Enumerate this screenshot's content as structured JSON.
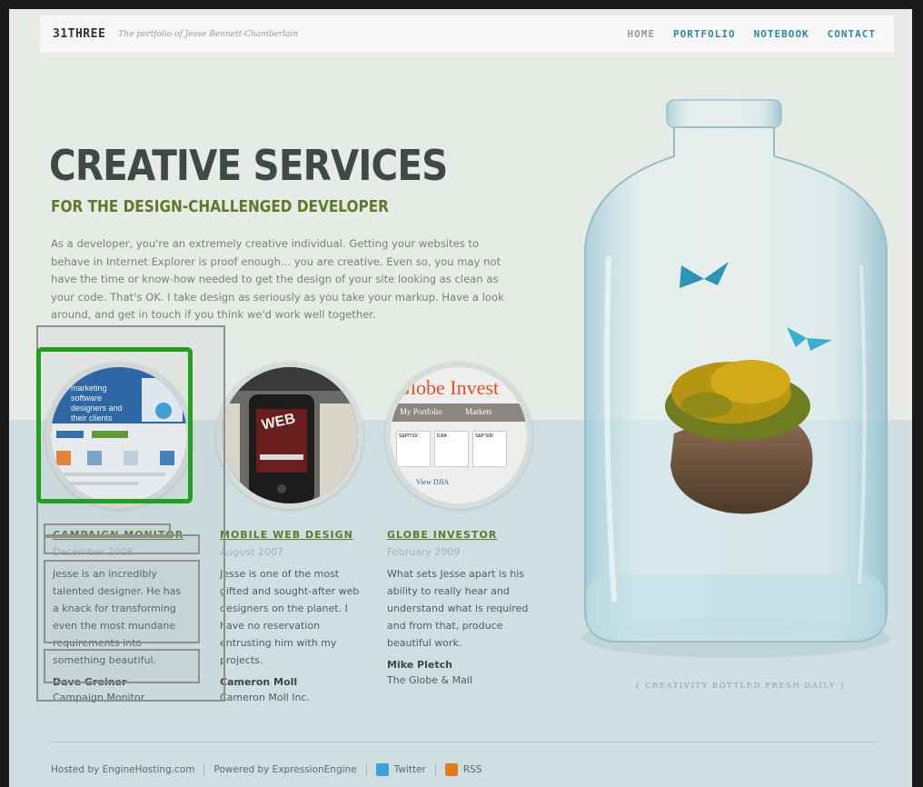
{
  "site": {
    "logo": "31THREE",
    "tagline": "The portfolio of Jesse Bennett-Chamberlain"
  },
  "nav": {
    "items": [
      "HOME",
      "PORTFOLIO",
      "NOTEBOOK",
      "CONTACT"
    ],
    "active": "HOME"
  },
  "hero": {
    "title": "CREATIVE SERVICES",
    "subtitle": "FOR THE DESIGN-CHALLENGED DEVELOPER",
    "intro": "As a developer, you're an extremely creative individual. Getting your websites to behave in Internet Explorer is proof enough... you are creative. Even so, you may not have the time or know-how needed to get the design of your site looking as clean as your code. That's OK. I take design as seriously as you take your markup. Have a look around, and get in touch if you think we'd work well together."
  },
  "projects": [
    {
      "title": "CAMPAIGN MONITOR",
      "date": "December 2008",
      "quote": "Jesse is an incredibly talented designer. He has a knack for transforming even the most mundane requirements into something beautiful.",
      "author": "Dave Greiner",
      "company": "Campaign Monitor",
      "thumb_text": "marketing software designers and their clients"
    },
    {
      "title": "MOBILE WEB DESIGN",
      "date": "August 2007",
      "quote": "Jesse is one of the most gifted and sought-after web designers on the planet. I have no reservation entrusting him with my projects.",
      "author": "Cameron Moll",
      "company": "Cameron Moll Inc.",
      "thumb_text": "WEB"
    },
    {
      "title": "GLOBE INVESTOR",
      "date": "February 2009",
      "quote": "What sets Jesse apart is his ability to really hear and understand what is required and from that, produce beautiful work.",
      "author": "Mike Pletch",
      "company": "The Globe & Mail",
      "thumb_text": "Globe Invest",
      "thumb_tabs": [
        "My Portfolio",
        "Markets"
      ],
      "thumb_tickers": [
        "S&P/TSX",
        "DJIA",
        "S&P 500"
      ],
      "thumb_link": "View DJIA"
    }
  ],
  "jar": {
    "caption": "{ CREATIVITY BOTTLED FRESH DAILY }"
  },
  "footer": {
    "hosted": "Hosted by EngineHosting.com",
    "powered": "Powered by ExpressionEngine",
    "twitter": "Twitter",
    "rss": "RSS"
  },
  "colors": {
    "accent_green": "#5b7a2a",
    "nav_blue": "#2b8aa5",
    "highlight_green": "#1fa01f",
    "twitter_icon": "#36a6d6",
    "rss_icon": "#e07d1a"
  }
}
